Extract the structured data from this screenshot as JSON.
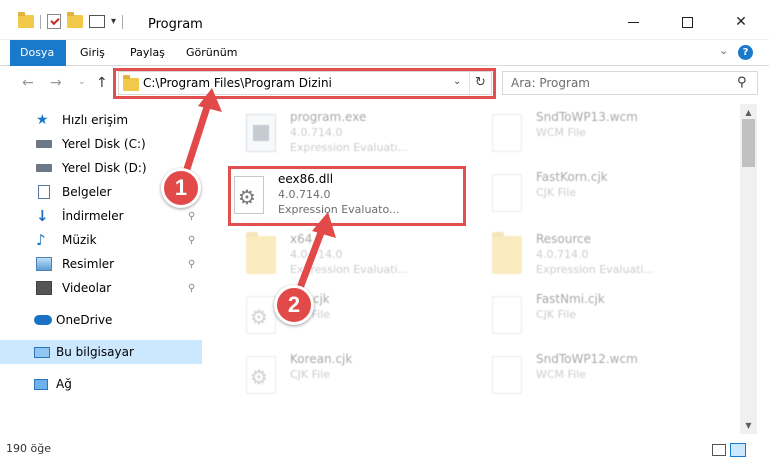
{
  "window": {
    "title": "Program",
    "minimize_label": "",
    "maximize_label": "",
    "close_label": "✕"
  },
  "ribbon": {
    "tabs": [
      {
        "label": "Dosya",
        "active": true
      },
      {
        "label": "Giriş",
        "active": false
      },
      {
        "label": "Paylaş",
        "active": false
      },
      {
        "label": "Görünüm",
        "active": false
      }
    ],
    "help_label": "?"
  },
  "nav": {
    "back": "←",
    "forward": "→",
    "history": "⌄",
    "up": "↑",
    "address": "C:\\Program Files\\Program Dizini",
    "refresh": "↻",
    "dropdown": "⌄",
    "search_placeholder": "Ara: Program",
    "search_icon": "⚲"
  },
  "sidebar": {
    "items": [
      {
        "label": "Hızlı erişim",
        "icon": "star-icon"
      },
      {
        "label": "Yerel Disk (C:)",
        "icon": "disk-icon"
      },
      {
        "label": "Yerel Disk (D:)",
        "icon": "disk-icon"
      },
      {
        "label": "Belgeler",
        "icon": "document-icon"
      },
      {
        "label": "İndirmeler",
        "icon": "download-icon"
      },
      {
        "label": "Müzik",
        "icon": "music-icon"
      },
      {
        "label": "Resimler",
        "icon": "pictures-icon"
      },
      {
        "label": "Videolar",
        "icon": "video-icon"
      },
      {
        "label": "OneDrive",
        "icon": "cloud-icon"
      },
      {
        "label": "Bu bilgisayar",
        "icon": "computer-icon",
        "selected": true
      },
      {
        "label": "Ağ",
        "icon": "network-icon"
      }
    ],
    "pin": "⚲"
  },
  "files": [
    {
      "name": "program.exe",
      "line2": "4.0.714.0",
      "line3": "Expression Evaluatı...",
      "type": "exe"
    },
    {
      "name": "SndToWP13.wcm",
      "line2": "WCM File",
      "line3": "",
      "type": "doc"
    },
    {
      "name": "eex86.dll",
      "line2": "4.0.714.0",
      "line3": "Expression Evaluato...",
      "type": "gear"
    },
    {
      "name": "FastKorn.cjk",
      "line2": "CJK File",
      "line3": "",
      "type": "doc"
    },
    {
      "name": "x64",
      "line2": "4.0.714.0",
      "line3": "Expression Evaluati...",
      "type": "folder"
    },
    {
      "name": "Resource",
      "line2": "4.0.714.0",
      "line3": "Expression Evaluati...",
      "type": "folder"
    },
    {
      "name": "...n.cjk",
      "line2": "CJK File",
      "line3": "",
      "type": "gear"
    },
    {
      "name": "FastNmi.cjk",
      "line2": "CJK File",
      "line3": "",
      "type": "doc"
    },
    {
      "name": "Korean.cjk",
      "line2": "CJK File",
      "line3": "",
      "type": "gear"
    },
    {
      "name": "SndToWP12.wcm",
      "line2": "WCM File",
      "line3": "",
      "type": "doc"
    }
  ],
  "status": {
    "count": "190 öğe"
  },
  "scrollbar": {
    "up": "▲",
    "down": "▼"
  },
  "markers": [
    "1",
    "2"
  ],
  "colors": {
    "accent": "#1979ca",
    "highlight": "#e14f4f",
    "marker": "#e24a4a",
    "selected": "#cce8ff"
  }
}
